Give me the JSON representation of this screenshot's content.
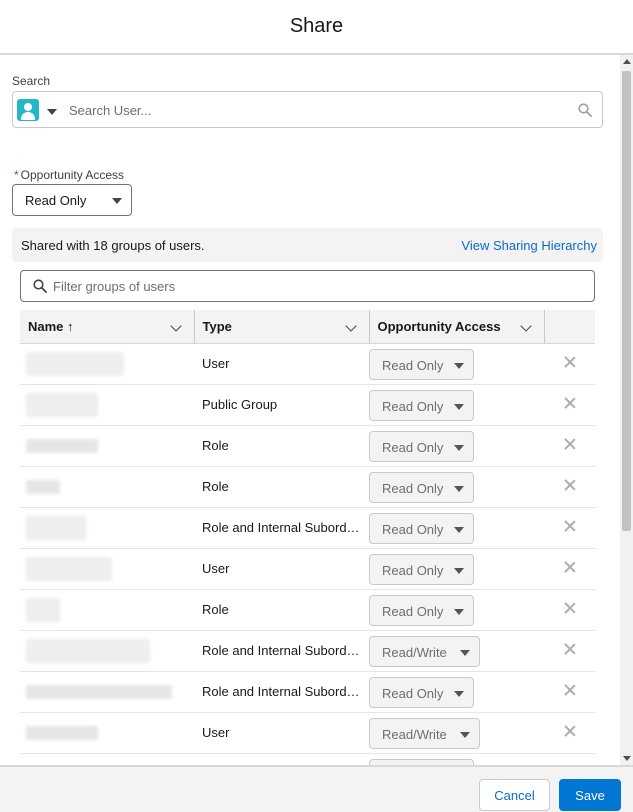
{
  "modal": {
    "title": "Share"
  },
  "search": {
    "label": "Search",
    "placeholder": "Search User..."
  },
  "opportunity_access": {
    "label": "Opportunity Access",
    "required_marker": "*",
    "value": "Read Only"
  },
  "info": {
    "text": "Shared with 18 groups of users.",
    "link": "View Sharing Hierarchy"
  },
  "filter": {
    "placeholder": "Filter groups of users"
  },
  "table": {
    "columns": {
      "name": "Name ↑",
      "type": "Type",
      "access": "Opportunity Access"
    },
    "rows": [
      {
        "type": "User",
        "access": "Read Only"
      },
      {
        "type": "Public Group",
        "access": "Read Only"
      },
      {
        "type": "Role",
        "access": "Read Only"
      },
      {
        "type": "Role",
        "access": "Read Only"
      },
      {
        "type": "Role and Internal Subordinates",
        "access": "Read Only"
      },
      {
        "type": "User",
        "access": "Read Only"
      },
      {
        "type": "Role",
        "access": "Read Only"
      },
      {
        "type": "Role and Internal Subordinates",
        "access": "Read/Write"
      },
      {
        "type": "Role and Internal Subordinates",
        "access": "Read Only"
      },
      {
        "type": "User",
        "access": "Read/Write"
      }
    ]
  },
  "footer": {
    "cancel": "Cancel",
    "save": "Save"
  }
}
